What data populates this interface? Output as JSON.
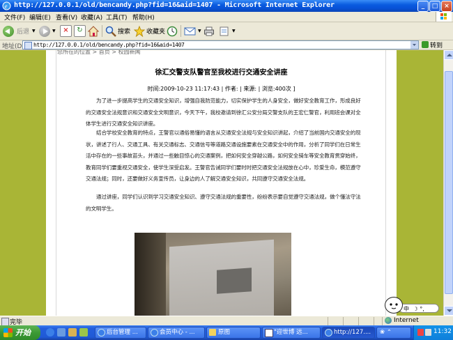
{
  "window": {
    "title": "http://127.0.0.1/old/bencandy.php?fid=16&aid=1407 - Microsoft Internet Explorer",
    "controls": [
      "_",
      "□",
      "×"
    ]
  },
  "menu": [
    "文件(F)",
    "编辑(E)",
    "查看(V)",
    "收藏(A)",
    "工具(T)",
    "帮助(H)"
  ],
  "toolbar": {
    "back": "后退",
    "search": "搜索",
    "favorites": "收藏夹"
  },
  "address": {
    "label": "地址(D)",
    "url": "http://127.0.0.1/old/bencandy.php?fid=16&aid=1407",
    "go": "转到"
  },
  "article": {
    "breadcrumb": "您所在的位置 > 首页 > 校园新闻",
    "title": "徐汇交警支队警官至我校进行交通安全讲座",
    "meta": "时间:2009-10-23 11:17:43 | 作者:  | 来源:  | 浏览:400次 ]",
    "paragraphs": [
      "为了进一步提高学生的交通安全知识，增强自我防范能力，切实保护学生的人身安全，做好安全教育工作，形成良好的交通安全法规意识和交通安全文明意识，今天下午，我校邀请到徐汇公安分局交警支队的王宏仁警官，利用班会课对全体学生进行交通安全知识讲座。",
      "结合学校安全教育的特点，王警官以通俗易懂的语言从交通安全法规与安全知识讲起，介绍了当前国内交通安全的现状，讲述了行人、交通工具、有关交通标志、交通信号等道路交通设施要素在交通安全中的作用，分析了同学们在日常生活中存在的一些事故苗头，并通过一些触目惊心的交通案例，把如何安全穿越公路，如何安全骑车等安全教育贯穿始终，教育同学们要重视交通安全，使学生深受启发。王警官告诫同学们要时时把交通安全法规放在心中，珍爱生命，模范遵守交通法规；同时，还要做好义务宣传员，让身边的人了解交通安全知识，共同遵守交通安全法规。",
      "通过讲座，同学们认识到学习交通安全知识、遵守交通法规的重要性，纷纷表示要自觉遵守交通法规，做个懂法守法的文明学生。"
    ]
  },
  "overlay": {
    "ime_label": "中"
  },
  "status": {
    "left": "完毕",
    "zone": "Internet"
  },
  "taskbar": {
    "start": "开始",
    "tasks": [
      {
        "label": "后台管理 ..."
      },
      {
        "label": "会员中心 - ..."
      },
      {
        "label": "原图"
      },
      {
        "label": "\"迎世博 远..."
      },
      {
        "label": "http://127...."
      }
    ],
    "clock": "11:32"
  }
}
